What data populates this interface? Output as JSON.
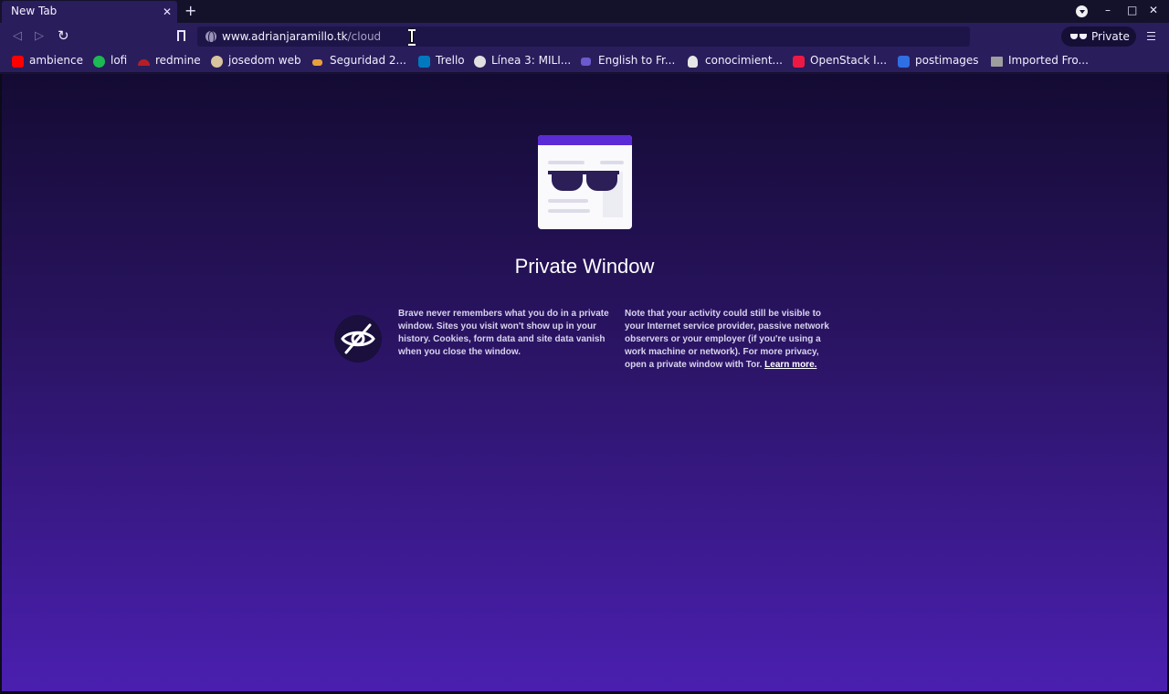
{
  "tab": {
    "title": "New Tab",
    "close": "✕"
  },
  "tabstrip": {
    "new_tab": "+",
    "minimize": "–",
    "maximize": "□",
    "close": "✕"
  },
  "toolbar": {
    "back": "◁",
    "forward": "▷",
    "reload": "↻",
    "url_host": "www.adrianjaramillo.tk",
    "url_path": "/cloud",
    "private_label": "Private"
  },
  "bookmarks": [
    {
      "label": "ambience",
      "icon": "youtube-icon",
      "color": "#ff0000"
    },
    {
      "label": "lofi",
      "icon": "spotify-icon",
      "color": "#1db954"
    },
    {
      "label": "redmine",
      "icon": "redmine-icon",
      "color": "#b32024"
    },
    {
      "label": "josedom web",
      "icon": "avatar-icon",
      "color": "#d9c4a0"
    },
    {
      "label": "Seguridad 2...",
      "icon": "seguridad-icon",
      "color": "#e8a13a"
    },
    {
      "label": "Trello",
      "icon": "trello-icon",
      "color": "#0079bf"
    },
    {
      "label": "Línea 3: MILI...",
      "icon": "globe-icon",
      "color": "#e0e0e0"
    },
    {
      "label": "English to Fr...",
      "icon": "translate-icon",
      "color": "#6a5acd"
    },
    {
      "label": "conocimient...",
      "icon": "linux-icon",
      "color": "#e6e6e6"
    },
    {
      "label": "OpenStack I...",
      "icon": "openstack-icon",
      "color": "#ed1944"
    },
    {
      "label": "postimages",
      "icon": "postimages-icon",
      "color": "#2f6fe4"
    },
    {
      "label": "Imported Fro...",
      "icon": "folder-icon",
      "color": "#9e9e9e"
    }
  ],
  "main": {
    "title": "Private Window",
    "left_text": "Brave never remembers what you do in a private window. Sites you visit won't show up in your history. Cookies, form data and site data vanish when you close the window.",
    "right_text": "Note that your activity could still be visible to your Internet service provider, passive network observers or your employer (if you're using a work machine or network). For more privacy, open a private window with Tor.",
    "learn_more": "Learn more."
  },
  "colors": {
    "accent": "#5b2bd6",
    "chrome": "#2a1d5c",
    "tabstrip": "#14122a"
  }
}
